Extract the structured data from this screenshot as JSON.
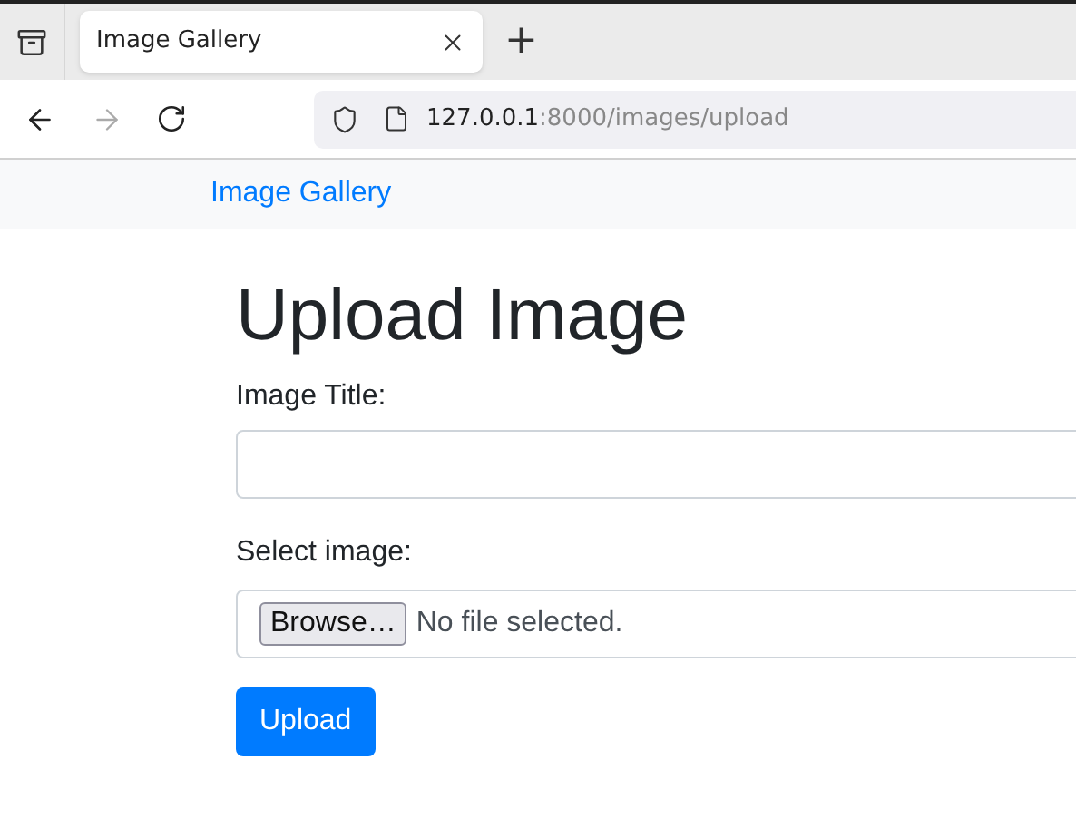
{
  "browser": {
    "tab": {
      "title": "Image Gallery",
      "selected": true
    },
    "new_tab": "+",
    "url": {
      "host": "127.0.0.1",
      "path": ":8000/images/upload"
    }
  },
  "navbar": {
    "brand": "Image Gallery"
  },
  "form": {
    "heading": "Upload Image",
    "title_field": {
      "label": "Image Title:"
    },
    "file_field": {
      "label": "Select image:",
      "button": "Browse…",
      "status": "No file selected."
    },
    "submit": "Upload"
  }
}
